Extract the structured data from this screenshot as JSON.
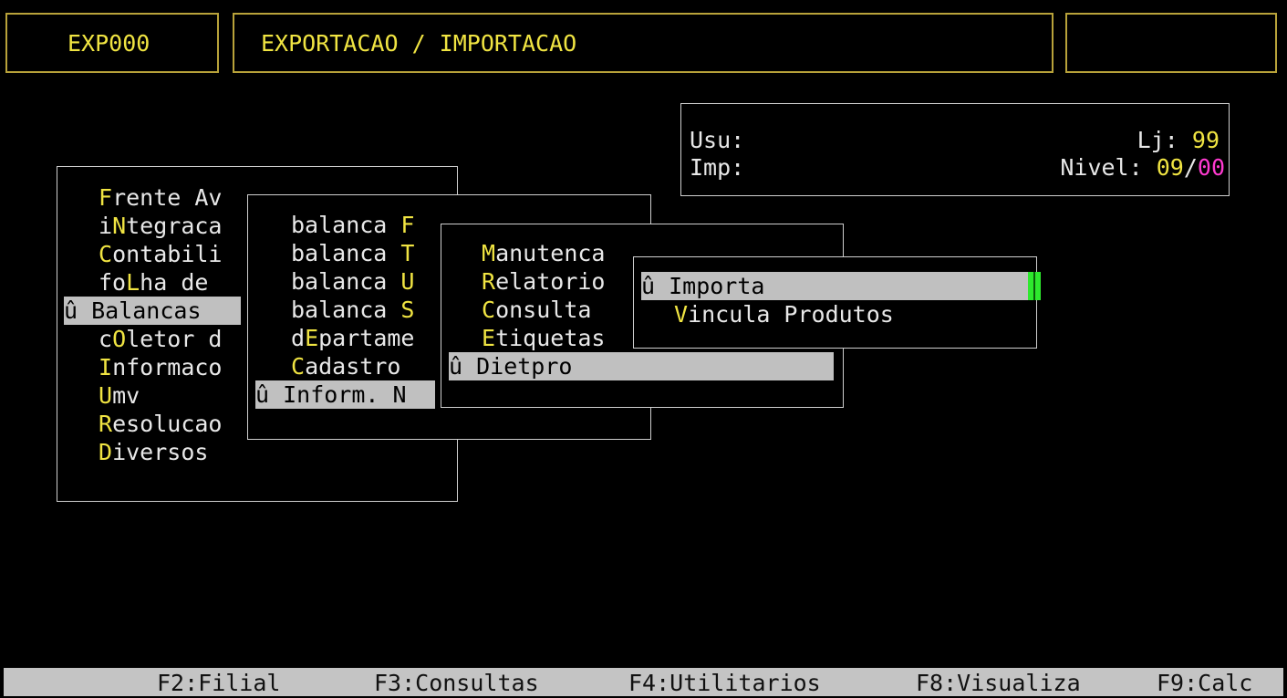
{
  "header": {
    "program_code": "EXP000",
    "program_title": "EXPORTACAO / IMPORTACAO",
    "right_box": ""
  },
  "info": {
    "usu_label": "Usu:",
    "imp_label": "Imp:",
    "lj_label": "Lj:",
    "lj_value": "99",
    "nivel_label": "Nivel:",
    "nivel_value_a": "09",
    "nivel_sep": "/",
    "nivel_value_b": "00"
  },
  "menu1": {
    "items": [
      {
        "prefix": "",
        "hotkey": "F",
        "rest": "rente Av"
      },
      {
        "prefix": "i",
        "hotkey": "N",
        "rest": "tegraca"
      },
      {
        "prefix": "",
        "hotkey": "C",
        "rest": "ontabili"
      },
      {
        "prefix": "fo",
        "hotkey": "L",
        "rest": "ha de"
      },
      {
        "label": "û Balancas",
        "selected": true
      },
      {
        "prefix": "c",
        "hotkey": "O",
        "rest": "letor d"
      },
      {
        "prefix": "",
        "hotkey": "I",
        "rest": "nformaco"
      },
      {
        "prefix": "",
        "hotkey": "U",
        "rest": "mv"
      },
      {
        "prefix": "",
        "hotkey": "R",
        "rest": "esolucao"
      },
      {
        "prefix": "",
        "hotkey": "D",
        "rest": "iversos"
      }
    ]
  },
  "menu2": {
    "items": [
      {
        "prefix": "balanca ",
        "hotkey": "F",
        "rest": ""
      },
      {
        "prefix": "balanca ",
        "hotkey": "T",
        "rest": ""
      },
      {
        "prefix": "balanca ",
        "hotkey": "U",
        "rest": ""
      },
      {
        "prefix": "balanca ",
        "hotkey": "S",
        "rest": ""
      },
      {
        "prefix": "d",
        "hotkey": "E",
        "rest": "partame"
      },
      {
        "prefix": "",
        "hotkey": "C",
        "rest": "adastro"
      },
      {
        "label": "û Inform. N",
        "selected": true
      }
    ]
  },
  "menu3": {
    "items": [
      {
        "prefix": "",
        "hotkey": "M",
        "rest": "anutenca"
      },
      {
        "prefix": "",
        "hotkey": "R",
        "rest": "elatorio"
      },
      {
        "prefix": "",
        "hotkey": "C",
        "rest": "onsulta"
      },
      {
        "prefix": "",
        "hotkey": "E",
        "rest": "tiquetas"
      },
      {
        "label": "û Dietpro",
        "selected": true
      }
    ]
  },
  "menu4": {
    "items": [
      {
        "label": "û Importa",
        "selected": true
      },
      {
        "prefix": "",
        "hotkey": "V",
        "rest": "incula Produtos"
      }
    ]
  },
  "function_keys": [
    {
      "label": "F2:Filial"
    },
    {
      "label": "F3:Consultas"
    },
    {
      "label": "F4:Utilitarios"
    },
    {
      "label": "F8:Visualiza"
    },
    {
      "label": "F9:Calc"
    }
  ]
}
